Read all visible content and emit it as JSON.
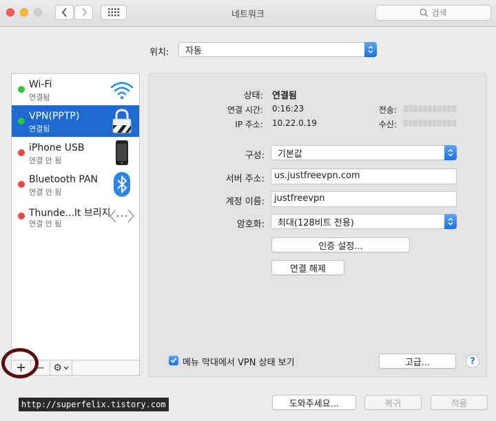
{
  "window": {
    "title": "네트워크",
    "search_placeholder": "검색"
  },
  "location": {
    "label": "위치:",
    "value": "자동"
  },
  "sidebar": {
    "items": [
      {
        "name": "Wi-Fi",
        "status": "연결됨",
        "dot": "#2ec43c",
        "icon": "wifi-icon"
      },
      {
        "name": "VPN(PPTP)",
        "status": "연결됨",
        "dot": "#2ec43c",
        "icon": "vpn-lock-icon",
        "selected": true
      },
      {
        "name": "iPhone USB",
        "status": "연결 안 됨",
        "dot": "#ec4545",
        "icon": "iphone-icon"
      },
      {
        "name": "Bluetooth PAN",
        "status": "연결 안 됨",
        "dot": "#ec4545",
        "icon": "bluetooth-icon"
      },
      {
        "name": "Thunde...lt 브리지",
        "status": "연결 안 됨",
        "dot": "#ec4545",
        "icon": "thunderbolt-bridge-icon"
      }
    ],
    "toolbar": {
      "add": "+",
      "remove": "−",
      "gear": "⚙"
    }
  },
  "status": {
    "label": "상태:",
    "value": "연결됨",
    "time_label": "연결 시간:",
    "time_value": "0:16:23",
    "ip_label": "IP 주소:",
    "ip_value": "10.22.0.19",
    "sent_label": "전송:",
    "received_label": "수신:"
  },
  "config": {
    "config_label": "구성:",
    "config_value": "기본값",
    "server_label": "서버 주소:",
    "server_value": "us.justfreevpn.com",
    "account_label": "계정 이름:",
    "account_value": "justfreevpn",
    "encryption_label": "암호화:",
    "encryption_value": "최대(128비트 전용)",
    "auth_button": "인증 설정...",
    "disconnect_button": "연결 해제"
  },
  "menu_bar": {
    "checkbox_label": "메뉴 막대에서 VPN 상태 보기",
    "checked": true
  },
  "buttons": {
    "advanced": "고급...",
    "help": "?",
    "assist": "도와주세요...",
    "revert": "복귀",
    "apply": "적용"
  },
  "watermark": "http://superfelix.tistory.com",
  "colors": {
    "accent": "#1f6ad2",
    "connected": "#2ec43c",
    "disconnected": "#ec4545",
    "annotation": "#5b0d15"
  }
}
